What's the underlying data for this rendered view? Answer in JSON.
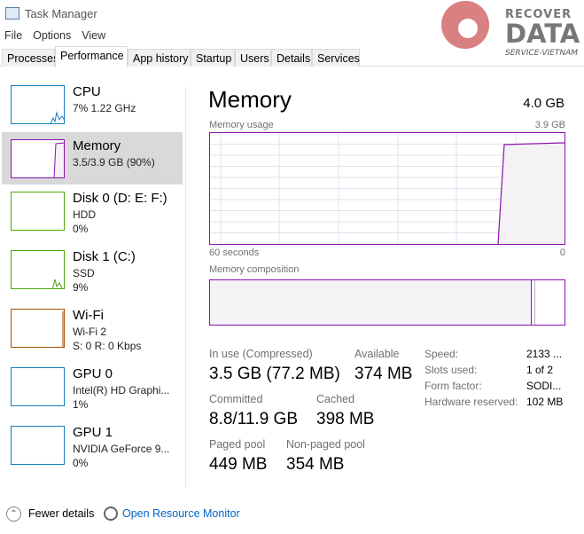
{
  "window": {
    "title": "Task Manager"
  },
  "menu": [
    "File",
    "Options",
    "View"
  ],
  "tabs": [
    "Processes",
    "Performance",
    "App history",
    "Startup",
    "Users",
    "Details",
    "Services"
  ],
  "active_tab": "Performance",
  "sidebar": [
    {
      "name": "CPU",
      "line2": "7%  1.22 GHz",
      "line3": "",
      "color": "#117dbb"
    },
    {
      "name": "Memory",
      "line2": "3.5/3.9 GB (90%)",
      "line3": "",
      "color": "#8b12ae",
      "selected": true
    },
    {
      "name": "Disk 0 (D: E: F:)",
      "line2": "HDD",
      "line3": "0%",
      "color": "#4da60c"
    },
    {
      "name": "Disk 1 (C:)",
      "line2": "SSD",
      "line3": "9%",
      "color": "#4da60c"
    },
    {
      "name": "Wi-Fi",
      "line2": "Wi-Fi 2",
      "line3": "S: 0  R: 0 Kbps",
      "color": "#a74f01"
    },
    {
      "name": "GPU 0",
      "line2": "Intel(R) HD Graphi...",
      "line3": "1%",
      "color": "#117dbb"
    },
    {
      "name": "GPU 1",
      "line2": "NVIDIA GeForce 9...",
      "line3": "0%",
      "color": "#117dbb"
    }
  ],
  "main": {
    "title": "Memory",
    "total": "4.0 GB",
    "usage_label": "Memory usage",
    "usage_max": "3.9 GB",
    "time_left": "60 seconds",
    "time_right": "0",
    "composition_label": "Memory composition",
    "usage_percent_now": 90,
    "stats": {
      "in_use_label": "In use (Compressed)",
      "in_use": "3.5 GB (77.2 MB)",
      "available_label": "Available",
      "available": "374 MB",
      "committed_label": "Committed",
      "committed": "8.8/11.9 GB",
      "cached_label": "Cached",
      "cached": "398 MB",
      "paged_label": "Paged pool",
      "paged": "449 MB",
      "nonpaged_label": "Non-paged pool",
      "nonpaged": "354 MB"
    },
    "hw": [
      {
        "label": "Speed:",
        "value": "2133 ..."
      },
      {
        "label": "Slots used:",
        "value": "1 of 2"
      },
      {
        "label": "Form factor:",
        "value": "SODI..."
      },
      {
        "label": "Hardware reserved:",
        "value": "102 MB"
      }
    ]
  },
  "footer": {
    "fewer": "Fewer details",
    "monitor": "Open Resource Monitor"
  },
  "watermark": {
    "line1": "RECOVER",
    "line2": "DATA",
    "line3": "SERVICE-VIETNAM"
  },
  "colors": {
    "memory": "#8b12ae",
    "memory_fill": "#f4f2f4",
    "link": "#0066cc"
  }
}
